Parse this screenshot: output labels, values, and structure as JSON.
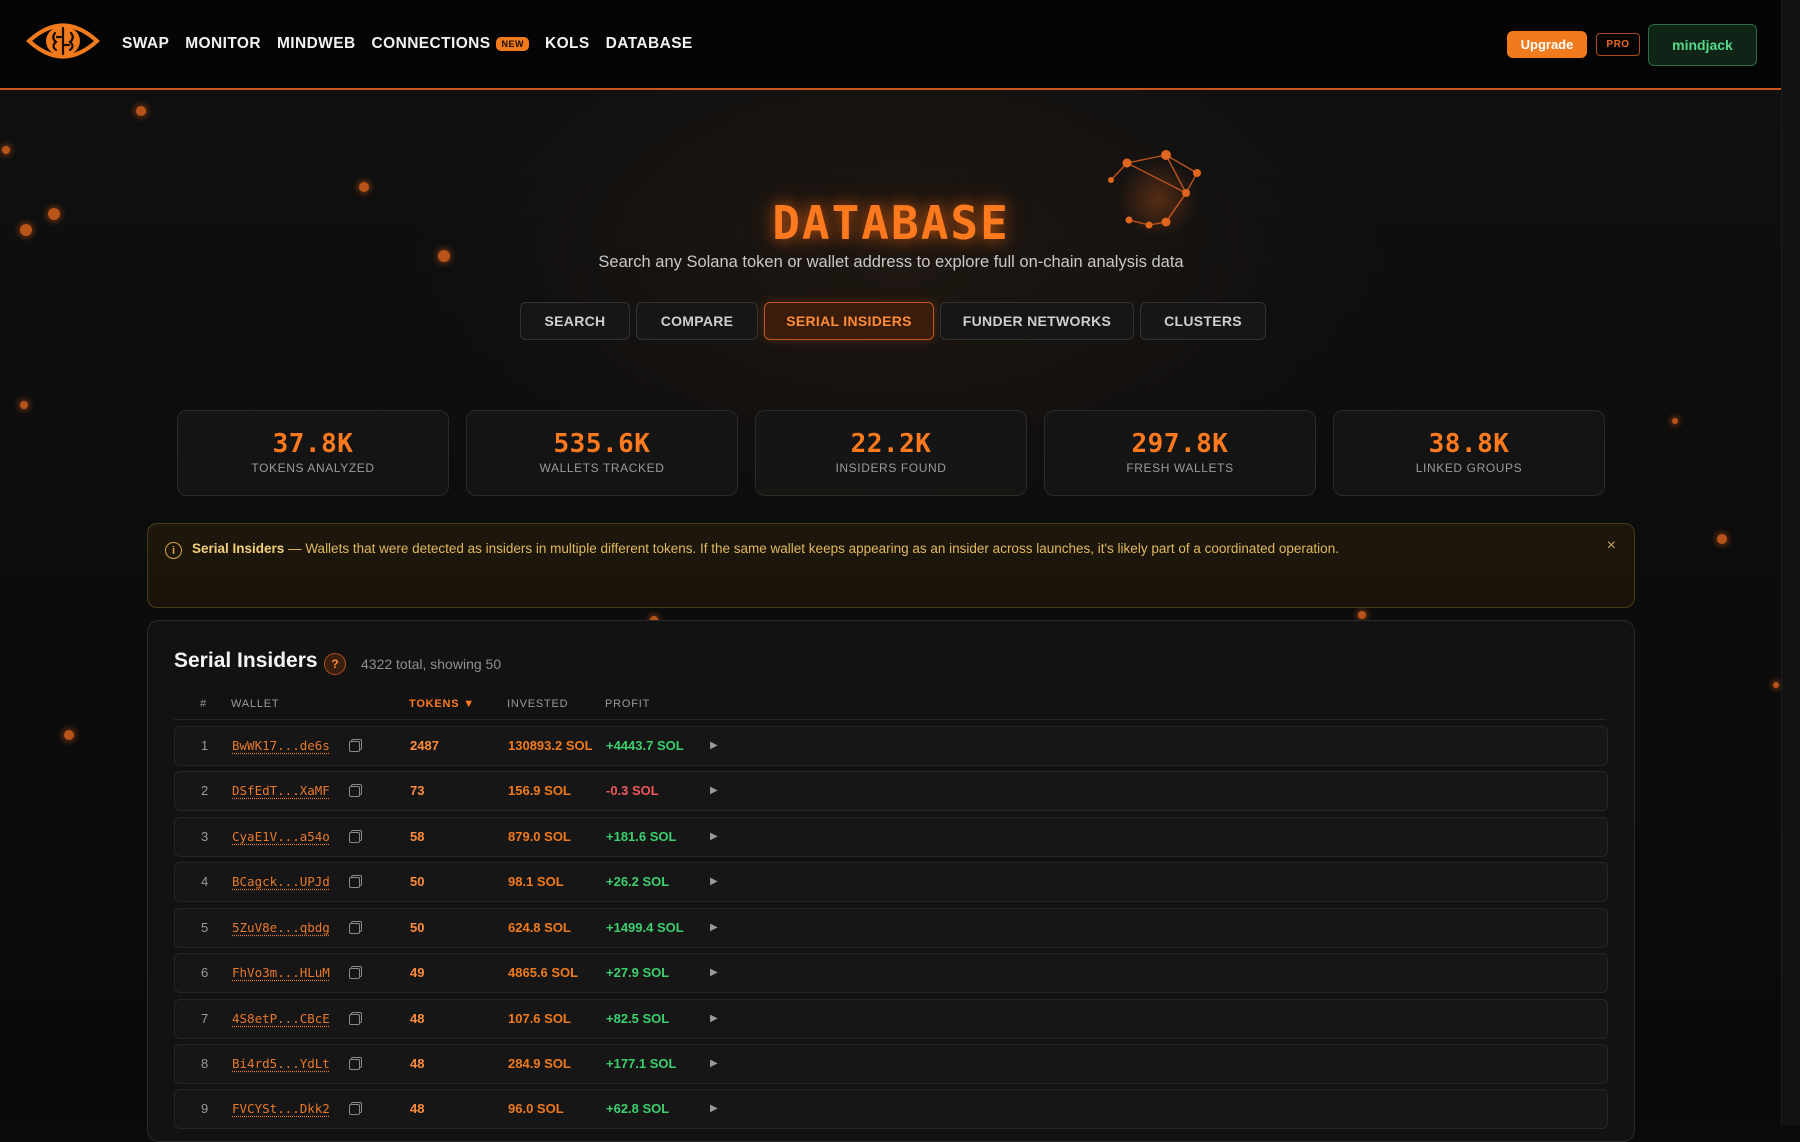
{
  "nav": {
    "items": [
      {
        "label": "SWAP"
      },
      {
        "label": "MONITOR"
      },
      {
        "label": "MINDWEB"
      },
      {
        "label": "CONNECTIONS",
        "badge": "NEW"
      },
      {
        "label": "KOLS"
      },
      {
        "label": "DATABASE"
      }
    ],
    "upgrade_label": "Upgrade",
    "pro_label": "PRO",
    "user_label": "mindjack"
  },
  "hero": {
    "title": "DATABASE",
    "subtitle": "Search any Solana token or wallet address to explore full on-chain analysis data"
  },
  "tabs": [
    {
      "label": "SEARCH"
    },
    {
      "label": "COMPARE"
    },
    {
      "label": "SERIAL INSIDERS",
      "active": true
    },
    {
      "label": "FUNDER NETWORKS"
    },
    {
      "label": "CLUSTERS"
    }
  ],
  "stats": [
    {
      "value": "37.8K",
      "label": "TOKENS ANALYZED"
    },
    {
      "value": "535.6K",
      "label": "WALLETS TRACKED"
    },
    {
      "value": "22.2K",
      "label": "INSIDERS FOUND"
    },
    {
      "value": "297.8K",
      "label": "FRESH WALLETS"
    },
    {
      "value": "38.8K",
      "label": "LINKED GROUPS"
    }
  ],
  "info": {
    "title": "Serial Insiders",
    "text": " — Wallets that were detected as insiders in multiple different tokens. If the same wallet keeps appearing as an insider across launches, it's likely part of a coordinated operation.",
    "close": "×",
    "icon": "info-icon"
  },
  "panel": {
    "title": "Serial Insiders",
    "help": "?",
    "meta": "4322 total, showing 50",
    "columns": {
      "num": "#",
      "wallet": "WALLET",
      "tokens": "TOKENS ▼",
      "invested": "INVESTED",
      "profit": "PROFIT"
    },
    "rows": [
      {
        "num": "1",
        "wallet": "BwWK17...de6s",
        "tokens": "2487",
        "invested": "130893.2 SOL",
        "profit": "+4443.7 SOL",
        "positive": true
      },
      {
        "num": "2",
        "wallet": "DSfEdT...XaMF",
        "tokens": "73",
        "invested": "156.9 SOL",
        "profit": "-0.3 SOL",
        "positive": false
      },
      {
        "num": "3",
        "wallet": "CyaE1V...a54o",
        "tokens": "58",
        "invested": "879.0 SOL",
        "profit": "+181.6 SOL",
        "positive": true
      },
      {
        "num": "4",
        "wallet": "BCagck...UPJd",
        "tokens": "50",
        "invested": "98.1 SOL",
        "profit": "+26.2 SOL",
        "positive": true
      },
      {
        "num": "5",
        "wallet": "5ZuV8e...qbdg",
        "tokens": "50",
        "invested": "624.8 SOL",
        "profit": "+1499.4 SOL",
        "positive": true
      },
      {
        "num": "6",
        "wallet": "FhVo3m...HLuM",
        "tokens": "49",
        "invested": "4865.6 SOL",
        "profit": "+27.9 SOL",
        "positive": true
      },
      {
        "num": "7",
        "wallet": "4S8etP...CBcE",
        "tokens": "48",
        "invested": "107.6 SOL",
        "profit": "+82.5 SOL",
        "positive": true
      },
      {
        "num": "8",
        "wallet": "Bi4rd5...YdLt",
        "tokens": "48",
        "invested": "284.9 SOL",
        "profit": "+177.1 SOL",
        "positive": true
      },
      {
        "num": "9",
        "wallet": "FVCYSt...Dkk2",
        "tokens": "48",
        "invested": "96.0 SOL",
        "profit": "+62.8 SOL",
        "positive": true
      }
    ],
    "expand_glyph": "▶"
  },
  "colors": {
    "accent": "#ff7a1f",
    "positive": "#3ccf6e",
    "negative": "#f0585c",
    "user": "#56d98a"
  }
}
